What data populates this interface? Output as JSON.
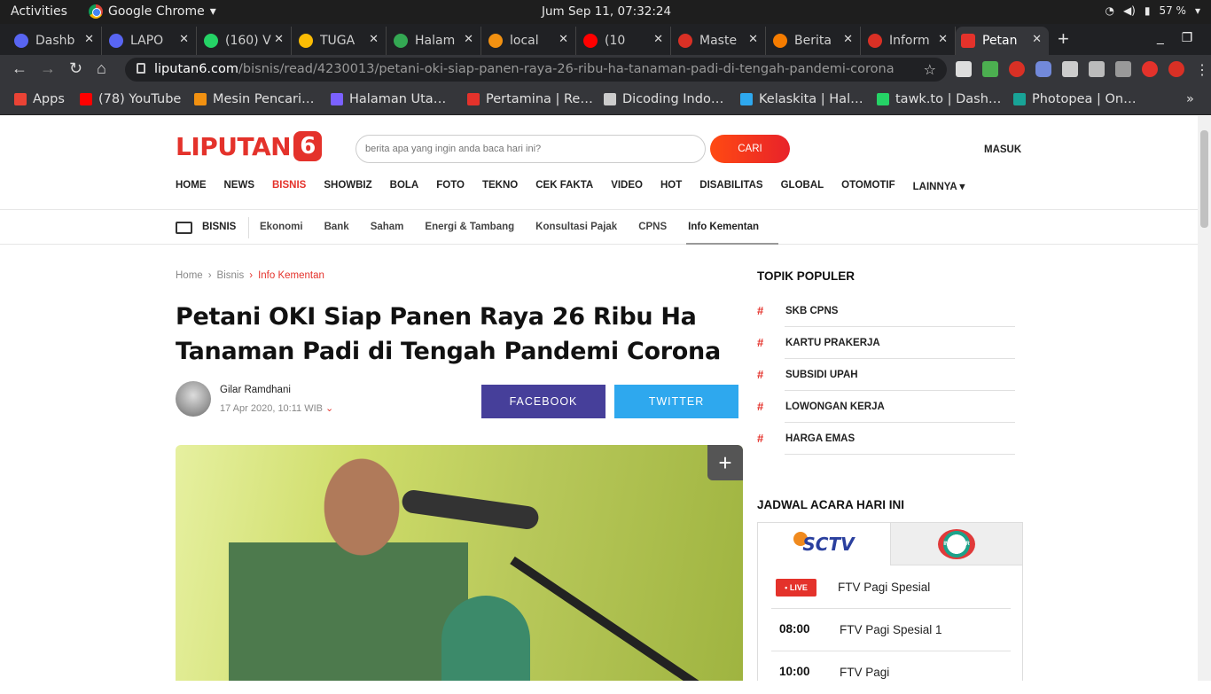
{
  "os": {
    "activities": "Activities",
    "app_name": "Google Chrome",
    "clock": "Jum Sep 11, 07:32:24",
    "battery": "57 %"
  },
  "tabs": [
    {
      "title": "Dashb",
      "color": "#5865f2"
    },
    {
      "title": "LAPO",
      "color": "#5865f2"
    },
    {
      "title": "(160) V",
      "color": "#25d366"
    },
    {
      "title": "TUGA",
      "color": "#fbbc04"
    },
    {
      "title": "Halam",
      "color": "#34a853"
    },
    {
      "title": "local",
      "color": "#f29111"
    },
    {
      "title": "(10 ",
      "color": "#ff0000"
    },
    {
      "title": "Maste",
      "color": "#d93025"
    },
    {
      "title": "Berita",
      "color": "#f57c00"
    },
    {
      "title": "Inform",
      "color": "#d93025"
    },
    {
      "title": "Petan",
      "color": "#e4322b"
    }
  ],
  "browser": {
    "url_host": "liputan6.com",
    "url_path": "/bisnis/read/4230013/petani-oki-siap-panen-raya-26-ribu-ha-tanaman-padi-di-tengah-pandemi-corona"
  },
  "bookmarks": [
    {
      "label": "Apps",
      "color": "#ea4335"
    },
    {
      "label": "(78) YouTube",
      "color": "#ff0000"
    },
    {
      "label": "Mesin Pencari…",
      "color": "#f29111"
    },
    {
      "label": "Halaman Uta…",
      "color": "#7b61ff"
    },
    {
      "label": "Pertamina | Re…",
      "color": "#e4322b"
    },
    {
      "label": "Dicoding Indo…",
      "color": "#cccccc"
    },
    {
      "label": "Kelaskita | Hal…",
      "color": "#2ea8ee"
    },
    {
      "label": "tawk.to | Dash…",
      "color": "#25d366"
    },
    {
      "label": "Photopea | On…",
      "color": "#18a497"
    }
  ],
  "site": {
    "logo_text": "LIPUTAN",
    "logo_num": "6",
    "search_placeholder": "berita apa yang ingin anda baca hari ini?",
    "search_button": "CARI",
    "login": "MASUK",
    "nav": [
      "HOME",
      "NEWS",
      "BISNIS",
      "SHOWBIZ",
      "BOLA",
      "FOTO",
      "TEKNO",
      "CEK FAKTA",
      "VIDEO",
      "HOT",
      "DISABILITAS",
      "GLOBAL",
      "OTOMOTIF",
      "LAINNYA ▾"
    ],
    "section": "BISNIS",
    "subnav": [
      "Ekonomi",
      "Bank",
      "Saham",
      "Energi & Tambang",
      "Konsultasi Pajak",
      "CPNS",
      "Info Kementan"
    ]
  },
  "article": {
    "breadcrumb": [
      "Home",
      "Bisnis",
      "Info Kementan"
    ],
    "title": "Petani OKI Siap Panen Raya 26 Ribu Ha Tanaman Padi di Tengah Pandemi Corona",
    "author": "Gilar Ramdhani",
    "date": "17 Apr 2020, 10:11 WIB",
    "share_facebook": "FACEBOOK",
    "share_twitter": "TWITTER"
  },
  "sidebar": {
    "topik_title": "TOPIK POPULER",
    "topik": [
      "SKB CPNS",
      "KARTU PRAKERJA",
      "SUBSIDI UPAH",
      "LOWONGAN KERJA",
      "HARGA EMAS"
    ],
    "jadwal_title": "JADWAL ACARA HARI INI",
    "channel1": "SCTV",
    "channel2": "INDOSIAR",
    "live_badge": "• LIVE",
    "schedule": [
      {
        "time": "",
        "program": "FTV Pagi Spesial"
      },
      {
        "time": "08:00",
        "program": "FTV Pagi Spesial 1"
      },
      {
        "time": "10:00",
        "program": "FTV Pagi"
      }
    ]
  }
}
